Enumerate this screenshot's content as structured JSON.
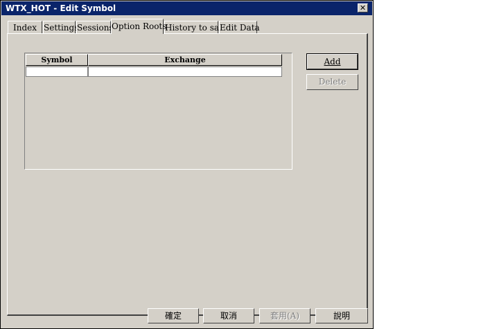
{
  "window": {
    "title": "WTX_HOT - Edit Symbol",
    "close_glyph": "✕"
  },
  "tabs": [
    {
      "label": "Index"
    },
    {
      "label": "Settings"
    },
    {
      "label": "Sessions"
    },
    {
      "label": "Option Roots"
    },
    {
      "label": "History to save"
    },
    {
      "label": "Edit Data"
    }
  ],
  "table": {
    "columns": [
      "Symbol",
      "Exchange"
    ],
    "rows": [
      [
        "",
        ""
      ]
    ]
  },
  "side_buttons": {
    "add": "Add",
    "delete": "Delete"
  },
  "footer_buttons": {
    "ok": "確定",
    "cancel": "取消",
    "apply": "套用(A)",
    "help": "說明"
  }
}
